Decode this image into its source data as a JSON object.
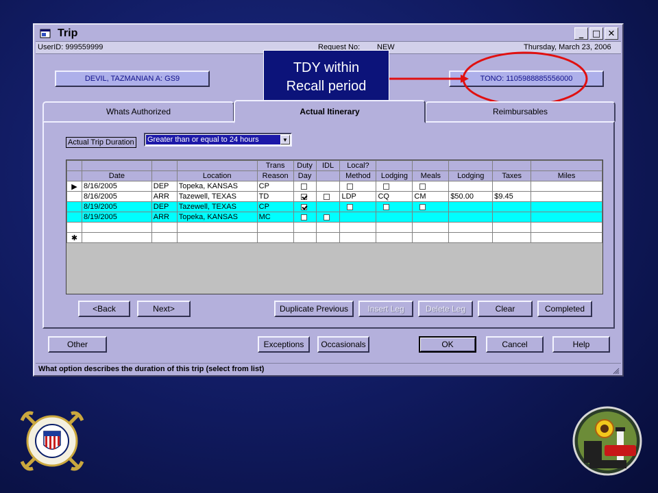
{
  "window": {
    "title": "Trip",
    "controls": {
      "minimize": "_",
      "maximize": "□",
      "close": "✕"
    }
  },
  "infobar": {
    "user": "UserID: 999559999",
    "request_label": "Request No:",
    "request_value": "NEW",
    "date": "Thursday, March 23, 2006"
  },
  "header": {
    "name_button": "DEVIL, TAZMANIAN A: GS9",
    "tono_button": "TONO: 1105988885556000"
  },
  "callout": {
    "line1": "TDY within",
    "line2": "Recall period"
  },
  "tabs": [
    {
      "label": "Whats Authorized"
    },
    {
      "label": "Actual Itinerary"
    },
    {
      "label": "Reimbursables"
    }
  ],
  "duration": {
    "label": "Actual Trip Duration",
    "value": "Greater than or equal to 24 hours",
    "arrow": "▼"
  },
  "grid": {
    "header_top": [
      "",
      "",
      "",
      "",
      "Trans",
      "Duty",
      "IDL",
      "Local?",
      "",
      "",
      "",
      "",
      ""
    ],
    "header_bottom": [
      "",
      "Date",
      "",
      "Location",
      "Reason",
      "Day",
      "",
      "Method",
      "Lodging",
      "Meals",
      "Lodging",
      "Taxes",
      "Miles"
    ],
    "rows": [
      {
        "marker": "▶",
        "date": "8/16/2005",
        "type": "DEP",
        "location": "Topeka, KANSAS",
        "reason": "CP",
        "duty": false,
        "idl": null,
        "local": false,
        "method": "",
        "lodging_chk": false,
        "meals_chk": false,
        "lodging_code": "",
        "meals_code": "",
        "lodging_amt": "",
        "taxes": "",
        "miles": "",
        "style": "w"
      },
      {
        "marker": "",
        "date": "8/16/2005",
        "type": "ARR",
        "location": "Tazewell,  TEXAS",
        "reason": "TD",
        "duty": true,
        "idl": false,
        "local": null,
        "method": "LDP",
        "lodging_code": "CQ",
        "meals_code": "CM",
        "lodging_amt": "$50.00",
        "taxes": "$9.45",
        "miles": "",
        "style": "w"
      },
      {
        "marker": "",
        "date": "8/19/2005",
        "type": "DEP",
        "location": "Tazewell,  TEXAS",
        "reason": "CP",
        "duty": true,
        "idl": null,
        "local": false,
        "method": "",
        "lodging_chk": false,
        "meals_chk": false,
        "lodging_code": "",
        "meals_code": "",
        "lodging_amt": "",
        "taxes": "",
        "miles": "",
        "style": "c"
      },
      {
        "marker": "",
        "date": "8/19/2005",
        "type": "ARR",
        "location": "Topeka, KANSAS",
        "reason": "MC",
        "duty": false,
        "idl": false,
        "local": null,
        "method": "",
        "lodging_code": "",
        "meals_code": "",
        "lodging_amt": "",
        "taxes": "",
        "miles": "",
        "style": "c"
      },
      {
        "marker": "",
        "style": "w",
        "empty": true
      },
      {
        "marker": "✱",
        "style": "w",
        "empty": true
      }
    ]
  },
  "nav_buttons": {
    "back": "<Back",
    "next": "Next>",
    "duplicate": "Duplicate Previous",
    "insert": "Insert Leg",
    "delete": "Delete Leg",
    "clear": "Clear",
    "completed": "Completed"
  },
  "bottom_buttons": {
    "other": "Other",
    "exceptions": "Exceptions",
    "occasionals": "Occasionals",
    "ok": "OK",
    "cancel": "Cancel",
    "help": "Help"
  },
  "status": "What option describes the duration of this trip (select from list)",
  "colors": {
    "window": "#b4b0dc",
    "highlight_row": "#00ffff",
    "callout": "#0c137a",
    "annotation_red": "#e01010"
  }
}
